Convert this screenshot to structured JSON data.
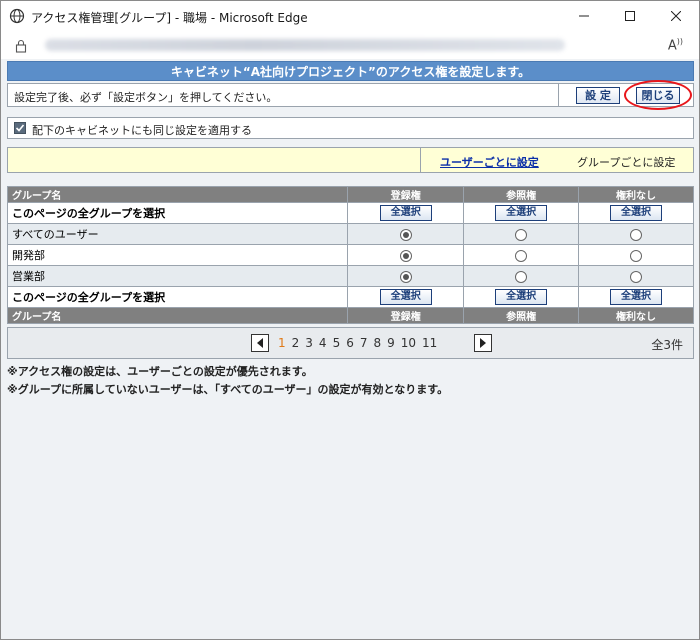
{
  "window": {
    "title": "アクセス権管理[グループ] - 職場 - Microsoft Edge",
    "read_aloud_label": "A‍̑"
  },
  "banner": {
    "text": "キャビネット“A社向けプロジェクト”のアクセス権を設定します。"
  },
  "notice": {
    "text": "設定完了後、必ず「設定ボタン」を押してください。",
    "set_button": "設 定",
    "close_button": "閉じる"
  },
  "apply": {
    "checked": true,
    "label": "配下のキャビネットにも同じ設定を適用する"
  },
  "mode": {
    "by_user_link": "ユーザーごとに設定",
    "by_group_label": "グループごとに設定"
  },
  "grid": {
    "headers": [
      "グループ名",
      "登録権",
      "参照権",
      "権利なし"
    ],
    "select_all_label": "このページの全グループを選択",
    "select_button": "全選択",
    "rows": [
      {
        "name": "すべてのユーザー",
        "selected": 0
      },
      {
        "name": "開発部",
        "selected": 0
      },
      {
        "name": "営業部",
        "selected": 0
      }
    ]
  },
  "pager": {
    "pages": [
      "1",
      "2",
      "3",
      "4",
      "5",
      "6",
      "7",
      "8",
      "9",
      "10",
      "11"
    ],
    "current": "1",
    "total": "全3件"
  },
  "footnotes": [
    "※アクセス権の設定は、ユーザーごとの設定が優先されます。",
    "※グループに所属していないユーザーは、「すべてのユーザー」の設定が有効となります。"
  ],
  "colors": {
    "banner": "#5b8ec9",
    "highlight_ring": "#e8161b",
    "header_row": "#808080",
    "mode_bar": "#ffffd6",
    "current_page": "#e07a18"
  }
}
